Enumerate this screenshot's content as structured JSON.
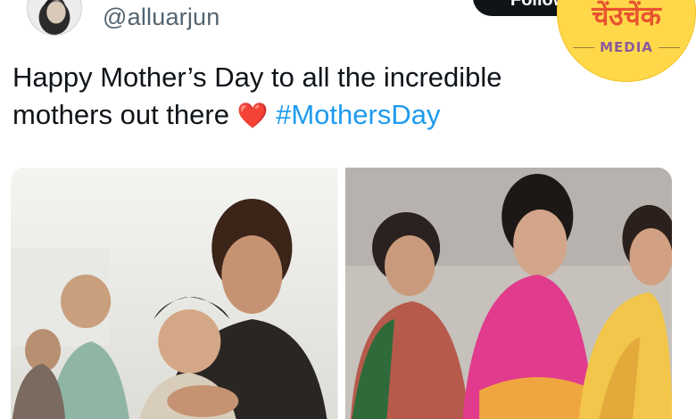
{
  "tweet": {
    "handle": "@alluarjun",
    "follow_label": "Follow",
    "text_line1": "Happy Mother’s Day to all the incredible",
    "text_line2_prefix": "mothers out there",
    "heart_emoji": "❤️",
    "hashtag": "#MothersDay",
    "media": [
      {
        "icon": "photo-icon",
        "description": "photo-1"
      },
      {
        "icon": "photo-icon",
        "description": "photo-2"
      }
    ]
  },
  "watermark": {
    "title": "चेंउचेंक",
    "subtitle": "MEDIA"
  },
  "colors": {
    "hashtag": "#1d9bf0",
    "handle": "#536471",
    "text": "#0f1419",
    "heart": "#e0245e",
    "watermark_bg": "#ffd84a",
    "watermark_title": "#e8532f"
  }
}
